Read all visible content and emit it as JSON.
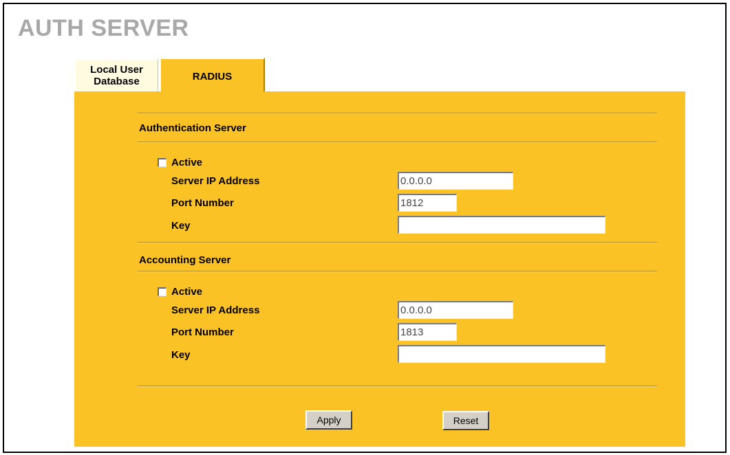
{
  "page": {
    "title": "AUTH SERVER"
  },
  "tabs": [
    {
      "label_line1": "Local User",
      "label_line2": "Database"
    },
    {
      "label": "RADIUS",
      "active": true
    }
  ],
  "auth_server": {
    "title": "Authentication Server",
    "active_label": "Active",
    "active_checked": false,
    "ip_label": "Server IP Address",
    "ip_value": "0.0.0.0",
    "port_label": "Port Number",
    "port_value": "1812",
    "key_label": "Key",
    "key_value": ""
  },
  "acct_server": {
    "title": "Accounting Server",
    "active_label": "Active",
    "active_checked": false,
    "ip_label": "Server IP Address",
    "ip_value": "0.0.0.0",
    "port_label": "Port Number",
    "port_value": "1813",
    "key_label": "Key",
    "key_value": ""
  },
  "buttons": {
    "apply": "Apply",
    "reset": "Reset"
  },
  "colors": {
    "panel": "#fbc226",
    "inactive_tab": "#fffbe1",
    "title": "#a8a8a8"
  }
}
